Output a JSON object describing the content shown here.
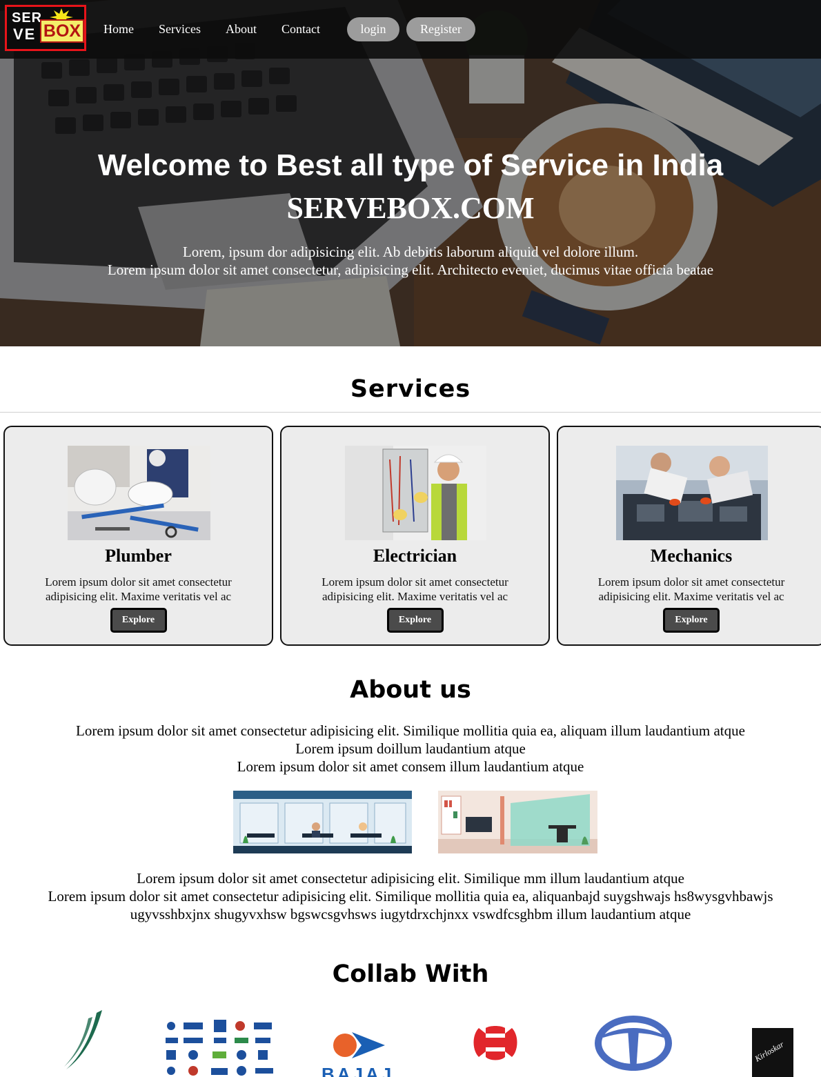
{
  "brand": {
    "logo_top": "SER",
    "logo_bottom": "VE",
    "logo_box": "BOX"
  },
  "nav": {
    "links": [
      "Home",
      "Services",
      "About",
      "Contact"
    ],
    "login_label": "login",
    "register_label": "Register"
  },
  "hero": {
    "title": "Welcome to Best all type of Service in India",
    "brand": "SERVEBOX.COM",
    "lines": [
      "Lorem, ipsum dor adipisicing elit. Ab debitis laborum aliquid vel dolore illum.",
      "Lorem ipsum dolor sit amet consectetur, adipisicing elit. Architecto eveniet, ducimus vitae officia beatae"
    ]
  },
  "services": {
    "title": "Services",
    "cards": [
      {
        "name": "Plumber",
        "text": "Lorem ipsum dolor sit amet consectetur adipisicing elit. Maxime veritatis vel ac",
        "button": "Explore",
        "image_icon": "plumber-photo"
      },
      {
        "name": "Electrician",
        "text": "Lorem ipsum dolor sit amet consectetur adipisicing elit. Maxime veritatis vel ac",
        "button": "Explore",
        "image_icon": "electrician-photo"
      },
      {
        "name": "Mechanics",
        "text": "Lorem ipsum dolor sit amet consectetur adipisicing elit. Maxime veritatis vel ac",
        "button": "Explore",
        "image_icon": "mechanics-photo"
      }
    ]
  },
  "about": {
    "title": "About us",
    "paragraph_1": [
      "Lorem ipsum dolor sit amet consectetur adipisicing elit. Similique mollitia quia ea, aliquam illum laudantium atque",
      "Lorem ipsum doillum laudantium atque",
      "Lorem ipsum dolor sit amet consem illum laudantium atque"
    ],
    "paragraph_2": [
      "Lorem ipsum dolor sit amet consectetur adipisicing elit. Similique mm illum laudantium atque",
      "Lorem ipsum dolor sit amet consectetur adipisicing elit. Similique mollitia quia ea, aliquanbajd suygshwajs hs8wysgvhbawjs",
      "ugyvsshbxjnx shugyvxhsw bgswcsgvhsws iugytdrxchjnxx vswdfcsghbm illum laudantium atque"
    ]
  },
  "collab": {
    "title": "Collab With",
    "partners": [
      "green-swoosh-logo",
      "partner-logo-grid",
      "bajaj-logo",
      "red-h-logo",
      "tata-logo",
      "kirloskar-logo"
    ],
    "partner_texts": {
      "bajaj": "BAJAJ",
      "kirloskar": "Kirloskar"
    }
  },
  "colors": {
    "navbar": "#0c0c0c",
    "nav_button": "#9c9c9c",
    "card_bg": "#ececec",
    "explore_button": "#4b4b4b",
    "logo_red": "#e8141a",
    "logo_yellow": "#f4ee6a",
    "tata_blue": "#4a6cc0",
    "bajaj_blue": "#1a5fb4"
  }
}
